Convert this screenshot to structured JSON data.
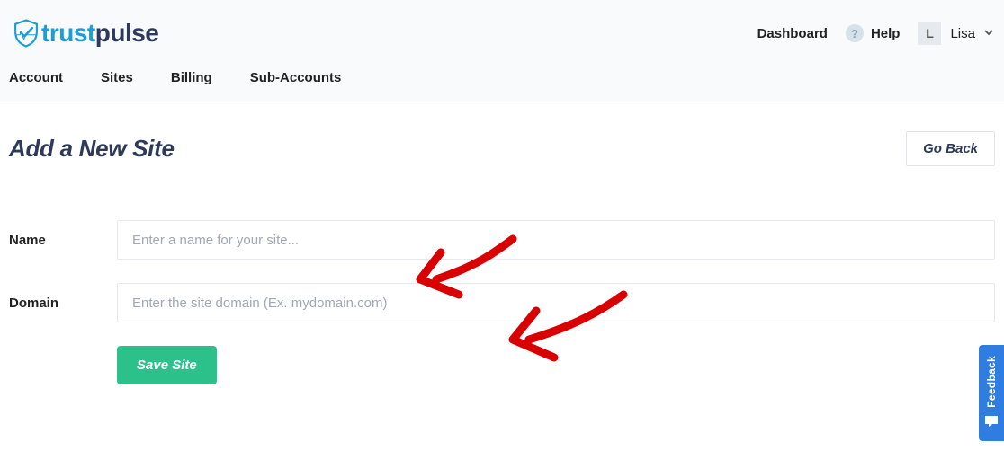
{
  "brand": {
    "part1": "trust",
    "part2": "pulse"
  },
  "header": {
    "dashboard": "Dashboard",
    "help": "Help",
    "user_initial": "L",
    "user_name": "Lisa"
  },
  "nav": {
    "account": "Account",
    "sites": "Sites",
    "billing": "Billing",
    "subaccounts": "Sub-Accounts"
  },
  "page": {
    "title": "Add a New Site",
    "go_back": "Go Back"
  },
  "form": {
    "name_label": "Name",
    "name_placeholder": "Enter a name for your site...",
    "domain_label": "Domain",
    "domain_placeholder": "Enter the site domain (Ex. mydomain.com)",
    "save_label": "Save Site"
  },
  "feedback": {
    "label": "Feedback"
  }
}
